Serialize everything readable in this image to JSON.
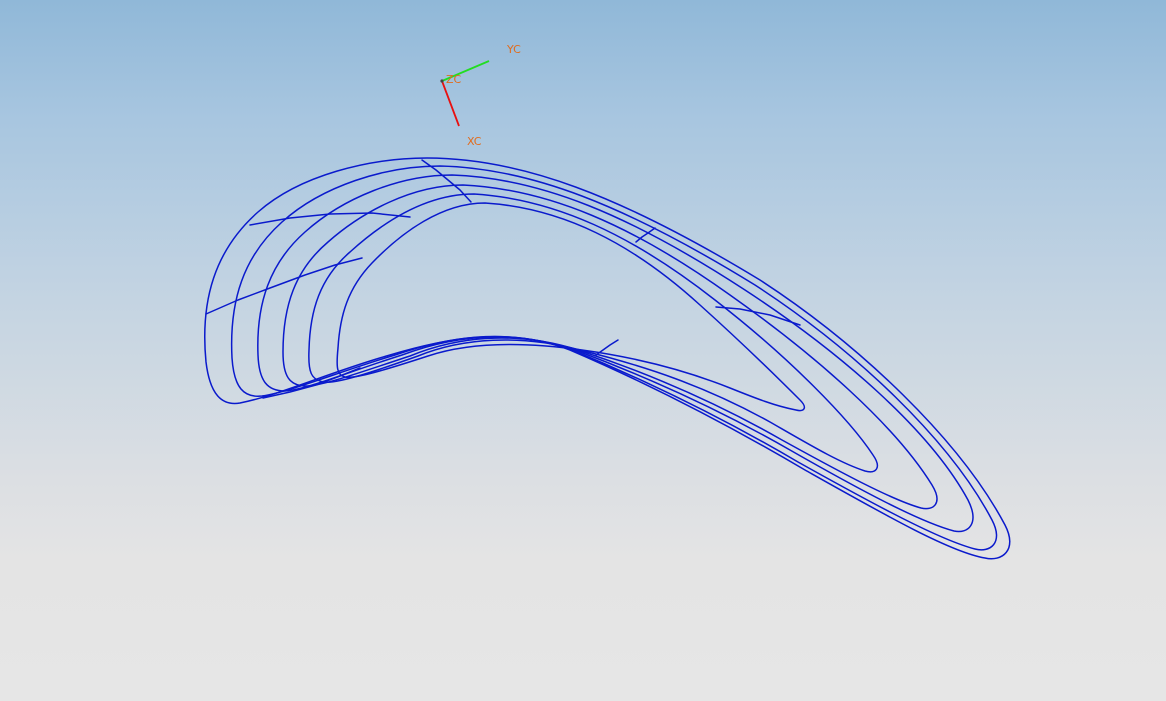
{
  "triad": {
    "x_label": "XC",
    "y_label": "YC",
    "z_label": "ZC",
    "x_color": "#e81010",
    "y_color": "#22dd22",
    "label_color": "#e06c1e"
  },
  "model": {
    "wire_color": "#0a1acc"
  }
}
